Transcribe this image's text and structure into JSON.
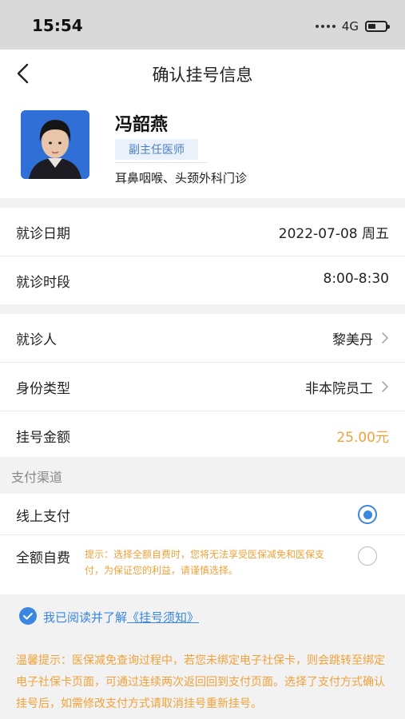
{
  "status_bar": {
    "time": "15:54",
    "network": "4G"
  },
  "nav": {
    "title": "确认挂号信息"
  },
  "doctor": {
    "name": "冯韶燕",
    "title": "副主任医师",
    "department": "耳鼻咽喉、头颈外科门诊"
  },
  "visit": {
    "date_label": "就诊日期",
    "date_value": "2022-07-08 周五",
    "time_label": "就诊时段",
    "time_value": "8:00-8:30"
  },
  "patient": {
    "patient_label": "就诊人",
    "patient_value": "黎美丹",
    "identity_label": "身份类型",
    "identity_value": "非本院员工",
    "fee_label": "挂号金额",
    "fee_value": "25.00元"
  },
  "payment": {
    "section_title": "支付渠道",
    "online_label": "线上支付",
    "online_selected": true,
    "self_pay_label": "全额自费",
    "self_pay_selected": false,
    "self_pay_hint": "提示：选择全额自费时，您将无法享受医保减免和医保支付，为保证您的利益，请谨慎选择。"
  },
  "agreement": {
    "prefix": "我已阅读并了解",
    "link": "《挂号须知》",
    "checked": true
  },
  "warm_tip": "温馨提示：医保减免查询过程中，若您未绑定电子社保卡，则会跳转至绑定电子社保卡页面，可通过连续两次返回回到支付页面。选择了支付方式确认挂号后，如需修改支付方式请取消挂号重新挂号。",
  "colors": {
    "accent_blue": "#3a86e0",
    "fee_orange": "#f0a23a",
    "avatar_bg": "#2f6fd6"
  },
  "icons": {
    "back": "chevron-left-icon",
    "row_arrow": "chevron-right-icon",
    "agree_check": "check-circle-icon"
  }
}
